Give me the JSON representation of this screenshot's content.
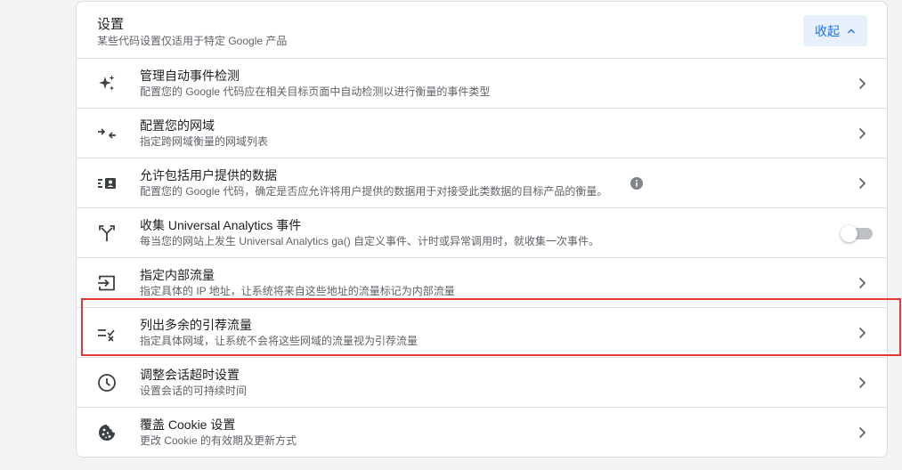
{
  "header": {
    "title": "设置",
    "subtitle": "某些代码设置仅适用于特定 Google 产品",
    "collapse_label": "收起"
  },
  "rows": [
    {
      "icon": "sparkle-icon",
      "title": "管理自动事件检测",
      "description": "配置您的 Google 代码应在相关目标页面中自动检测以进行衡量的事件类型"
    },
    {
      "icon": "merge-arrows-icon",
      "title": "配置您的网域",
      "description": "指定跨网域衡量的网域列表"
    },
    {
      "icon": "user-data-icon",
      "title": "允许包括用户提供的数据",
      "description": "配置您的 Google 代码，确定是否应允许将用户提供的数据用于对接受此类数据的目标产品的衡量。"
    },
    {
      "icon": "fork-icon",
      "title": "收集 Universal Analytics 事件",
      "description": "每当您的网站上发生 Universal Analytics ga() 自定义事件、计时或异常调用时，就收集一次事件。"
    },
    {
      "icon": "login-icon",
      "title": "指定内部流量",
      "description": "指定具体的 IP 地址，让系统将来自这些地址的流量标记为内部流量"
    },
    {
      "icon": "list-exclude-icon",
      "title": "列出多余的引荐流量",
      "description": "指定具体网域，让系统不会将这些网域的流量视为引荐流量"
    },
    {
      "icon": "clock-icon",
      "title": "调整会话超时设置",
      "description": "设置会话的可持续时间"
    },
    {
      "icon": "cookie-icon",
      "title": "覆盖 Cookie 设置",
      "description": "更改 Cookie 的有效期及更新方式"
    }
  ],
  "ua_toggle_on": false,
  "colors": {
    "accent": "#1a73e8",
    "highlight": "#e53935"
  }
}
